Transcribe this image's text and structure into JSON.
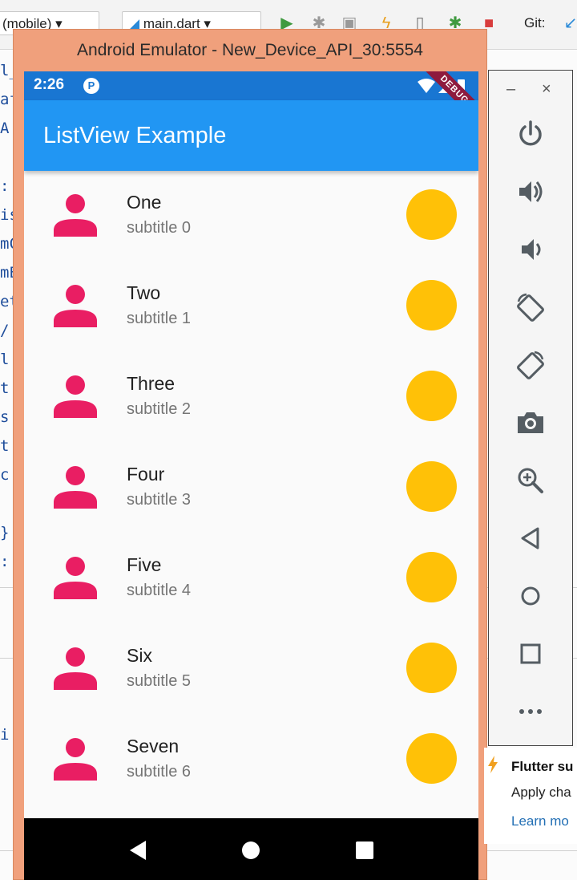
{
  "ide": {
    "device_combo": "(mobile)",
    "file_combo": "main.dart",
    "git_label": "Git:",
    "code_gutter": [
      "l_c",
      "af",
      " A",
      "",
      ":",
      "is",
      "mC",
      "mE",
      "et",
      " /",
      " l",
      " t",
      " s",
      " t",
      " c",
      "",
      " }",
      ":",
      "",
      "",
      "",
      "",
      "",
      "i"
    ]
  },
  "emulator": {
    "title": "Android Emulator - New_Device_API_30:5554",
    "status_time": "2:26",
    "status_notif_glyph": "P",
    "debug_banner": "DEBUG",
    "app_title": "ListView Example",
    "accent_color": "#2196f3",
    "icon_color": "#e91e63",
    "trailing_color": "#ffc107",
    "items": [
      {
        "title": "One",
        "subtitle": "subtitle 0"
      },
      {
        "title": "Two",
        "subtitle": "subtitle 1"
      },
      {
        "title": "Three",
        "subtitle": "subtitle 2"
      },
      {
        "title": "Four",
        "subtitle": "subtitle 3"
      },
      {
        "title": "Five",
        "subtitle": "subtitle 4"
      },
      {
        "title": "Six",
        "subtitle": "subtitle 5"
      },
      {
        "title": "Seven",
        "subtitle": "subtitle 6"
      }
    ]
  },
  "side_panel": {
    "minimize": "–",
    "close": "×",
    "buttons": [
      "power-icon",
      "volume-up-icon",
      "volume-down-icon",
      "rotate-left-icon",
      "rotate-right-icon",
      "camera-icon",
      "zoom-icon",
      "back-icon",
      "home-icon",
      "overview-icon",
      "more-icon"
    ]
  },
  "notification": {
    "title": "Flutter su",
    "body": "Apply cha",
    "link": "Learn mo"
  }
}
